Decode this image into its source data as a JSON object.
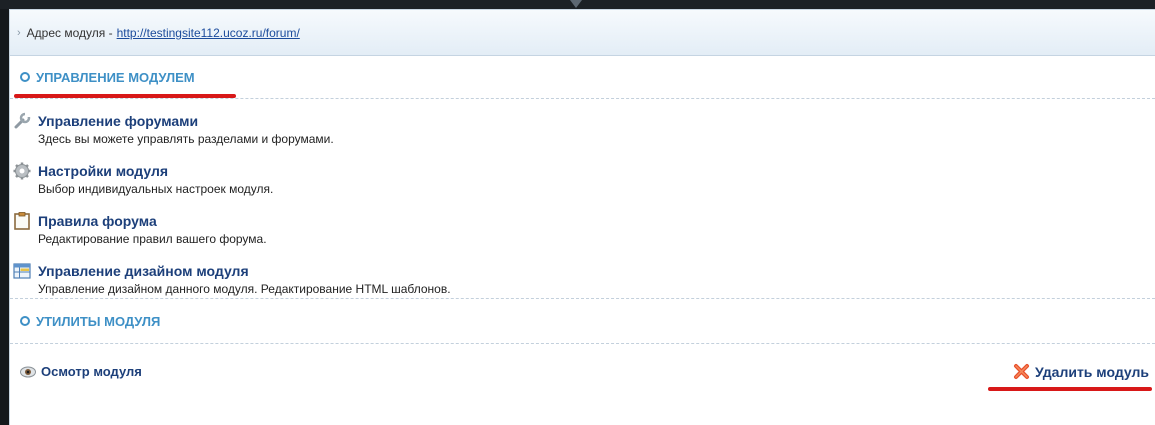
{
  "address": {
    "prefix": "Адрес модуля -",
    "link": "http://testingsite112.ucoz.ru/forum/"
  },
  "management": {
    "title": "УПРАВЛЕНИЕ МОДУЛЕМ",
    "items": [
      {
        "icon": "wrench-icon",
        "title": "Управление форумами",
        "desc": "Здесь вы можете управлять разделами и форумами."
      },
      {
        "icon": "gear-icon",
        "title": "Настройки модуля",
        "desc": "Выбор индивидуальных настроек модуля."
      },
      {
        "icon": "clipboard-icon",
        "title": "Правила форума",
        "desc": "Редактирование правил вашего форума."
      },
      {
        "icon": "table-icon",
        "title": "Управление дизайном модуля",
        "desc": "Управление дизайном данного модуля. Редактирование HTML шаблонов."
      }
    ]
  },
  "utilities": {
    "title": "УТИЛИТЫ МОДУЛЯ",
    "view_label": "Осмотр модуля",
    "delete_label": "Удалить модуль"
  },
  "colors": {
    "accent": "#3e90c6",
    "link": "#1c3f7a",
    "highlight": "#d81818"
  }
}
